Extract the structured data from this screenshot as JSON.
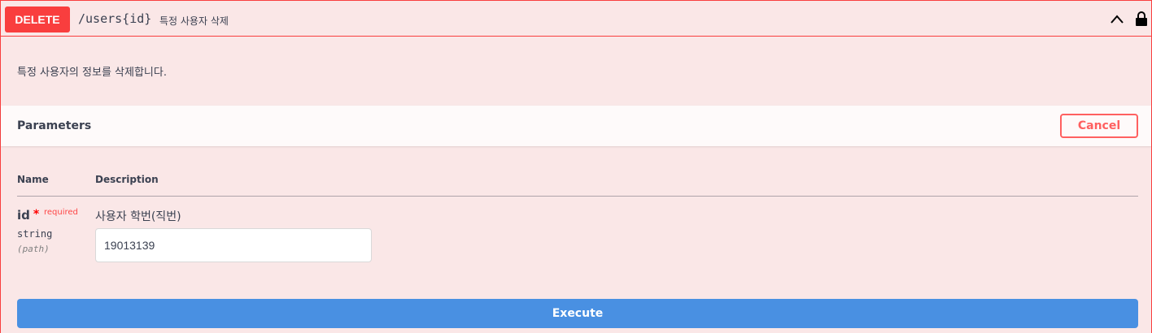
{
  "summary": {
    "method": "DELETE",
    "path": "/users{id}",
    "description": "특정 사용자 삭제"
  },
  "description": "특정 사용자의 정보를 삭제합니다.",
  "parameters": {
    "title": "Parameters",
    "cancel_label": "Cancel",
    "columns": {
      "name": "Name",
      "description": "Description"
    },
    "items": [
      {
        "name": "id",
        "required_star": "*",
        "required_label": "required",
        "type": "string",
        "in": "(path)",
        "description": "사용자 학번(직번)",
        "value": "19013139"
      }
    ]
  },
  "execute_label": "Execute",
  "colors": {
    "delete": "#f93e3e",
    "execute": "#4990e2",
    "background": "#fae7e7"
  },
  "icons": [
    "chevron-up-icon",
    "lock-icon"
  ]
}
